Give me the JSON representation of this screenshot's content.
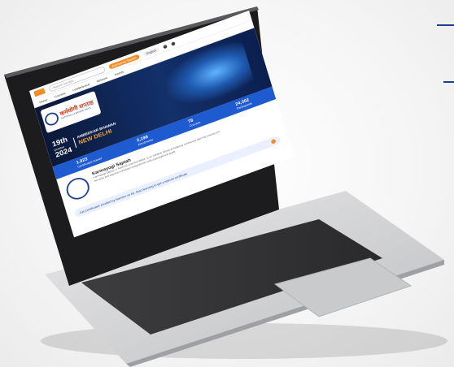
{
  "site": {
    "search_placeholder": "Search courses...",
    "nav_items": [
      "Home",
      "Courses",
      "Leaderboard",
      "Network",
      "Events"
    ],
    "top_pill": "Karmayogi Saptah",
    "lang": "English"
  },
  "hero": {
    "banner_title": "कर्मयोगी सप्ताह",
    "banner_subtitle": "NATIONAL LEARNING WEEK",
    "date_day": "19th",
    "date_month": "October",
    "date_year": "2024",
    "venue_line1": "AMBEDKAR BHAWAN",
    "venue_line2": "NEW DELHI"
  },
  "stats": [
    {
      "value": "1,923",
      "label": "Certificates Issued"
    },
    {
      "value": "2,198",
      "label": "Enrolments"
    },
    {
      "value": "78",
      "label": "Courses"
    },
    {
      "value": "24,362",
      "label": "Participants"
    }
  ],
  "about": {
    "title": "Karmayogi Saptah",
    "body": "Karmayogi Saptah, a National Learning Week, is an initiative aimed at fostering continuous learning among civil servants and aligning individual competencies with organisational goals."
  },
  "cta": {
    "text": "Get Certificates enrolled by learners so far. Start learning to get a special certificate"
  }
}
